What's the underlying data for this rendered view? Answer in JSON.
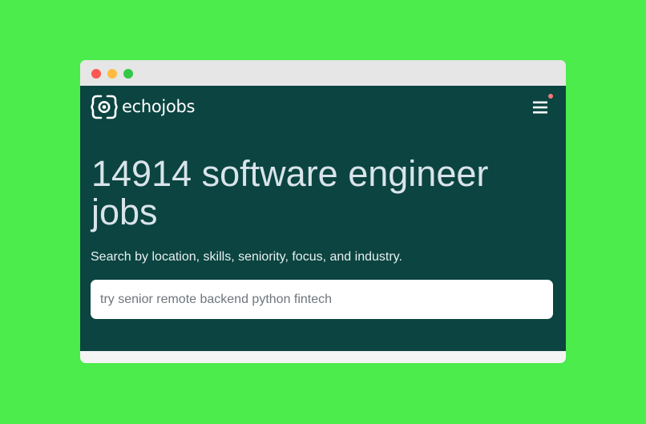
{
  "window": {
    "controls": [
      "close",
      "minimize",
      "maximize"
    ]
  },
  "header": {
    "logo_text": "echojobs",
    "logo_icon": "echojobs-logo-icon",
    "menu_icon": "hamburger-menu-icon",
    "notification_color": "#f1787a"
  },
  "hero": {
    "headline": "14914 software engineer jobs",
    "subtitle": "Search by location, skills, seniority, focus, and industry."
  },
  "search": {
    "placeholder": "try senior remote backend python fintech",
    "value": ""
  },
  "colors": {
    "page_background": "#4bec4b",
    "hero_background": "#0b4440",
    "headline_text": "#d9e4ea"
  }
}
